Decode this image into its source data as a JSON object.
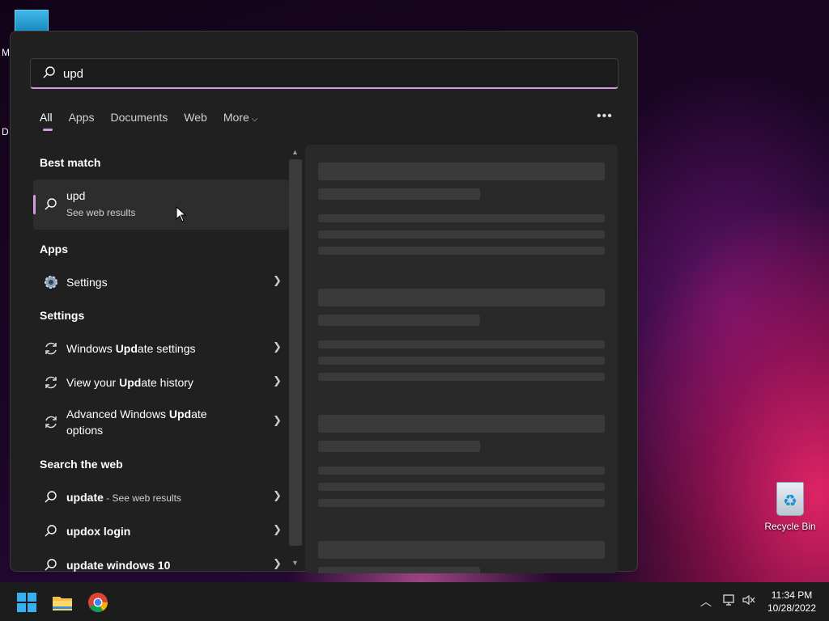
{
  "desktop": {
    "label_partial_1": "M",
    "label_partial_2": "D",
    "recycle_bin": "Recycle Bin"
  },
  "search": {
    "value": "upd",
    "placeholder": ""
  },
  "tabs": [
    {
      "label": "All",
      "active": true
    },
    {
      "label": "Apps"
    },
    {
      "label": "Documents"
    },
    {
      "label": "Web"
    },
    {
      "label": "More"
    }
  ],
  "sections": {
    "best_match": "Best match",
    "apps": "Apps",
    "settings": "Settings",
    "search_web": "Search the web"
  },
  "best_match": {
    "title": "upd",
    "subtitle": "See web results"
  },
  "apps": [
    {
      "label": "Settings",
      "icon": "gear-icon"
    }
  ],
  "settings": [
    {
      "pre": "Windows ",
      "bold": "Upd",
      "post": "ate settings"
    },
    {
      "pre": "View your ",
      "bold": "Upd",
      "post": "ate history"
    },
    {
      "pre": "Advanced Windows ",
      "bold": "Upd",
      "post": "ate",
      "line2": "options"
    }
  ],
  "web": [
    {
      "bold": "update",
      "suffix": " - See web results"
    },
    {
      "bold": "updox login",
      "suffix": ""
    },
    {
      "bold": "update windows 10",
      "suffix": ""
    }
  ],
  "taskbar": {
    "time": "11:34 PM",
    "date": "10/28/2022"
  },
  "colors": {
    "accent": "#d39be0",
    "panel": "#202020",
    "taskbar": "#1c1c1c"
  }
}
